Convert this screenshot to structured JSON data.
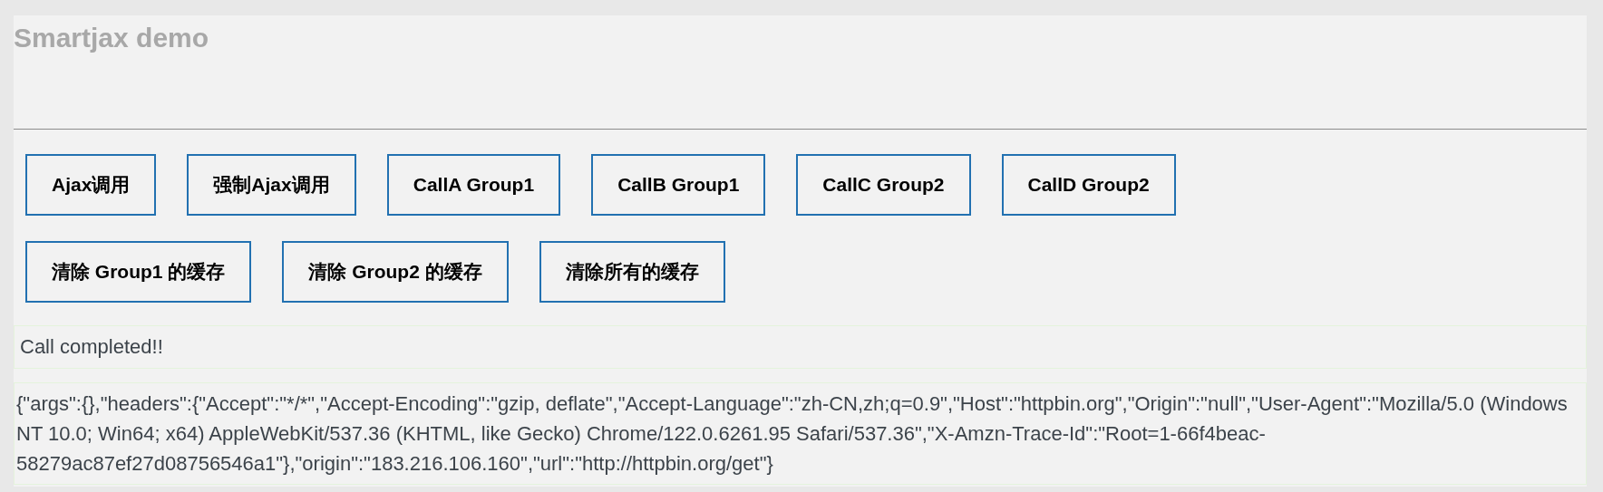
{
  "title": "Smartjax demo",
  "button_rows": [
    [
      "Ajax调用",
      "强制Ajax调用",
      "CallA Group1",
      "CallB Group1",
      "CallC Group2",
      "CallD Group2"
    ],
    [
      "清除 Group1 的缓存",
      "清除 Group2 的缓存",
      "清除所有的缓存"
    ]
  ],
  "status": "Call completed!!",
  "response": "{\"args\":{},\"headers\":{\"Accept\":\"*/*\",\"Accept-Encoding\":\"gzip, deflate\",\"Accept-Language\":\"zh-CN,zh;q=0.9\",\"Host\":\"httpbin.org\",\"Origin\":\"null\",\"User-Agent\":\"Mozilla/5.0 (Windows NT 10.0; Win64; x64) AppleWebKit/537.36 (KHTML, like Gecko) Chrome/122.0.6261.95 Safari/537.36\",\"X-Amzn-Trace-Id\":\"Root=1-66f4beac-58279ac87ef27d08756546a1\"},\"origin\":\"183.216.106.160\",\"url\":\"http://httpbin.org/get\"}"
}
